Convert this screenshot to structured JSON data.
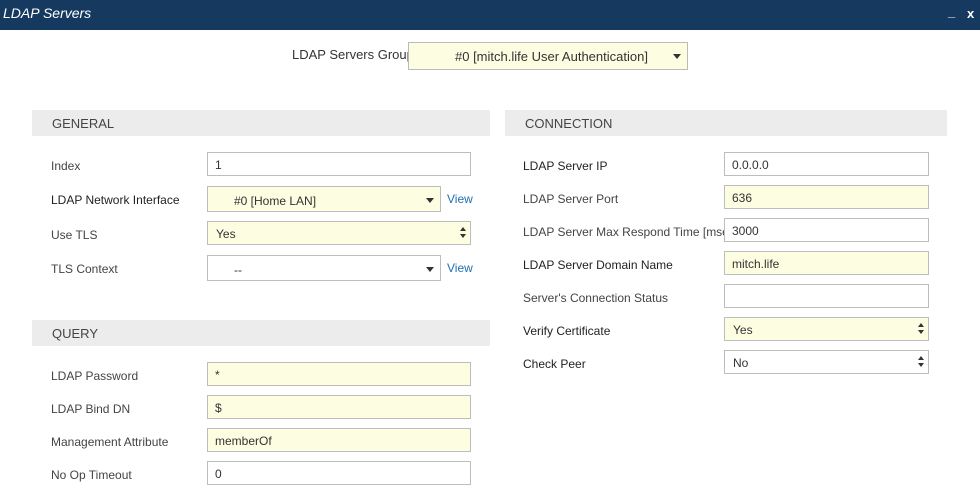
{
  "window": {
    "title": "LDAP Servers",
    "minimize_label": "_",
    "close_label": "x"
  },
  "group": {
    "label": "LDAP Servers Group",
    "value": "#0 [mitch.life User Authentication]"
  },
  "general": {
    "heading": "GENERAL",
    "index": {
      "label": "Index",
      "value": "1"
    },
    "network_interface": {
      "label": "LDAP Network Interface",
      "value": "#0 [Home LAN]",
      "view_label": "View"
    },
    "use_tls": {
      "label": "Use TLS",
      "value": "Yes"
    },
    "tls_context": {
      "label": "TLS Context",
      "value": "--",
      "view_label": "View"
    }
  },
  "query": {
    "heading": "QUERY",
    "password": {
      "label": "LDAP Password",
      "value": "*"
    },
    "bind_dn": {
      "label": "LDAP Bind DN",
      "value": "$"
    },
    "management_attribute": {
      "label": "Management Attribute",
      "value": "memberOf"
    },
    "no_op_timeout": {
      "label": "No Op Timeout",
      "value": "0"
    }
  },
  "connection": {
    "heading": "CONNECTION",
    "server_ip": {
      "label": "LDAP Server IP",
      "value": "0.0.0.0"
    },
    "server_port": {
      "label": "LDAP Server Port",
      "value": "636"
    },
    "max_respond_time": {
      "label": "LDAP Server Max Respond Time [msec]",
      "value": "3000"
    },
    "domain_name": {
      "label": "LDAP Server Domain Name",
      "value": "mitch.life"
    },
    "connection_status": {
      "label": "Server's Connection Status",
      "value": ""
    },
    "verify_certificate": {
      "label": "Verify Certificate",
      "value": "Yes"
    },
    "check_peer": {
      "label": "Check Peer",
      "value": "No"
    }
  },
  "colors": {
    "titlebar": "#163a5f",
    "section": "#ececec",
    "highlight_field": "#fdfde2",
    "link": "#1f6fb2"
  },
  "icons": {
    "dropdown": "chevron-down-icon",
    "spinner": "up-down-arrows-icon"
  }
}
